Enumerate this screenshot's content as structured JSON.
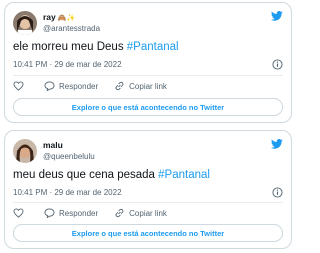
{
  "tweets": [
    {
      "display_name": "ray",
      "name_emoji": "🙈✨",
      "handle": "@arantesstrada",
      "text": "ele morreu meu Deus ",
      "hashtag": "#Pantanal",
      "timestamp": "10:41 PM · 29 de mar de 2022",
      "actions": {
        "reply_label": "Responder",
        "copy_label": "Copiar link"
      },
      "explore_label": "Explore o que está acontecendo no Twitter"
    },
    {
      "display_name": "malu",
      "name_emoji": "",
      "handle": "@queenbelulu",
      "text": "meu deus que cena pesada ",
      "hashtag": "#Pantanal",
      "timestamp": "10:41 PM · 29 de mar de 2022",
      "actions": {
        "reply_label": "Responder",
        "copy_label": "Copiar link"
      },
      "explore_label": "Explore o que está acontecendo no Twitter"
    }
  ],
  "colors": {
    "link": "#1d9bf0",
    "muted": "#536471",
    "border": "#cfd9de"
  }
}
